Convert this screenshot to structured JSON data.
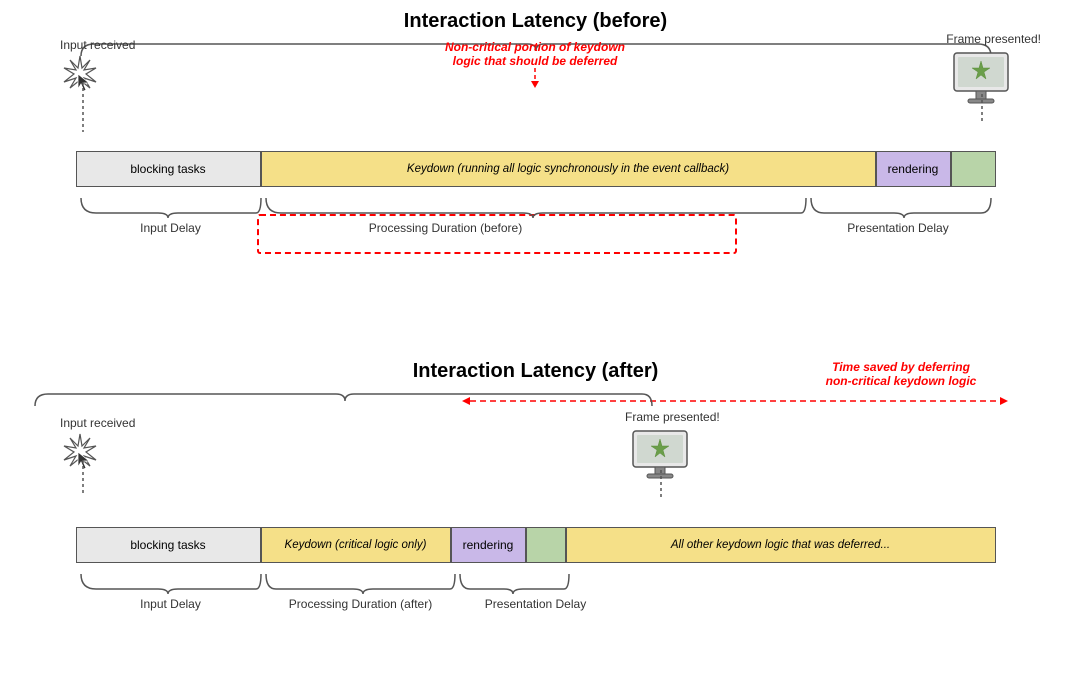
{
  "top": {
    "title": "Interaction Latency (before)",
    "input_received": "Input received",
    "frame_presented": "Frame presented!",
    "blocking_tasks": "blocking tasks",
    "keydown_label": "Keydown (running all logic synchronously in the event callback)",
    "rendering": "rendering",
    "non_critical_text_line1": "Non-critical portion of keydown",
    "non_critical_text_line2": "logic that should be deferred",
    "input_delay": "Input Delay",
    "processing_duration": "Processing Duration (before)",
    "presentation_delay": "Presentation Delay"
  },
  "bottom": {
    "title": "Interaction Latency (after)",
    "time_saved_line1": "Time saved by deferring",
    "time_saved_line2": "non-critical keydown logic",
    "input_received": "Input received",
    "frame_presented": "Frame presented!",
    "blocking_tasks": "blocking tasks",
    "keydown_label": "Keydown (critical logic only)",
    "rendering": "rendering",
    "deferred_label": "All other keydown logic that was deferred...",
    "input_delay": "Input Delay",
    "processing_duration": "Processing Duration (after)",
    "presentation_delay": "Presentation Delay"
  }
}
